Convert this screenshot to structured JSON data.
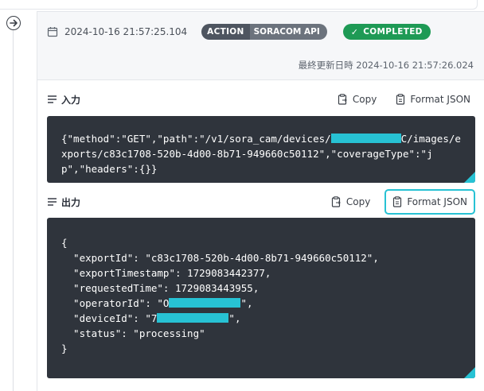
{
  "entry": {
    "timestamp": "2024-10-16 21:57:25.104",
    "badge_type": "ACTION",
    "badge_source": "SORACOM API",
    "status": "COMPLETED",
    "last_updated": "最終更新日時 2024-10-16 21:57:26.024"
  },
  "input_section": {
    "title": "入力",
    "copy_label": "Copy",
    "format_label": "Format JSON",
    "lines": {
      "l1_a": "{\"method\":\"GET\",\"path\":\"/v1/sora_cam/devices/",
      "l1_b": "C/images/e",
      "l2": "xports/c83c1708-520b-4d00-8b71-949660c50112\",\"coverageType\":\"j",
      "l3": "p\",\"headers\":{}}"
    }
  },
  "output_section": {
    "title": "出力",
    "copy_label": "Copy",
    "format_label": "Format JSON",
    "lines": {
      "open": "{",
      "export_id": "  \"exportId\": \"c83c1708-520b-4d00-8b71-949660c50112\",",
      "export_ts": "  \"exportTimestamp\": 1729083442377,",
      "requested": "  \"requestedTime\": 1729083443955,",
      "operator_a": "  \"operatorId\": \"O",
      "operator_b": "\",",
      "device_a": "  \"deviceId\": \"7",
      "device_b": "\",",
      "status": "  \"status\": \"processing\"",
      "close": "}"
    }
  },
  "icons": {
    "toggle": "arrow-circle-right-icon",
    "calendar": "calendar-icon",
    "section": "lines-icon",
    "copy": "clipboard-copy-icon",
    "format": "clipboard-format-icon"
  },
  "colors": {
    "code_bg": "#2f343c",
    "accent_cyan": "#27c2d4",
    "status_green": "#1e9a55",
    "badge_dark": "#4e5560",
    "badge_mid": "#6c737d"
  }
}
